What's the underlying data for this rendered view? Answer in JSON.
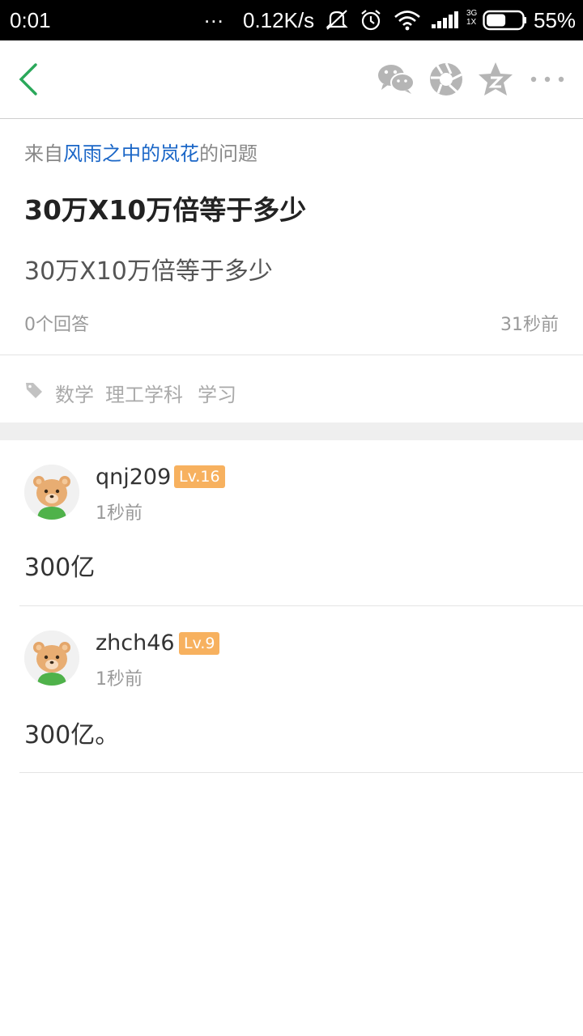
{
  "status_bar": {
    "time": "0:01",
    "dots": "...",
    "speed": "0.12K/s",
    "network_small_top": "3G",
    "network_small_bottom": "1X",
    "battery_percent": "55%",
    "battery_level": 0.55
  },
  "app_bar": {
    "icons": [
      "back-chevron-icon",
      "wechat-icon",
      "moments-icon",
      "qzone-star-icon",
      "more-icon"
    ],
    "accent_color": "#2aa85a"
  },
  "question": {
    "source_prefix": "来自",
    "source_user": "风雨之中的岚花",
    "source_suffix": "的问题",
    "title": "30万X10万倍等于多少",
    "body": "30万X10万倍等于多少",
    "answer_count": "0个回答",
    "time_ago": "31秒前"
  },
  "tags": [
    "数学",
    "理工学科",
    "学习"
  ],
  "answers": [
    {
      "username": "qnj209",
      "level": "Lv.16",
      "time": "1秒前",
      "text": "300亿"
    },
    {
      "username": "zhch46",
      "level": "Lv.9",
      "time": "1秒前",
      "text": "300亿。"
    }
  ]
}
